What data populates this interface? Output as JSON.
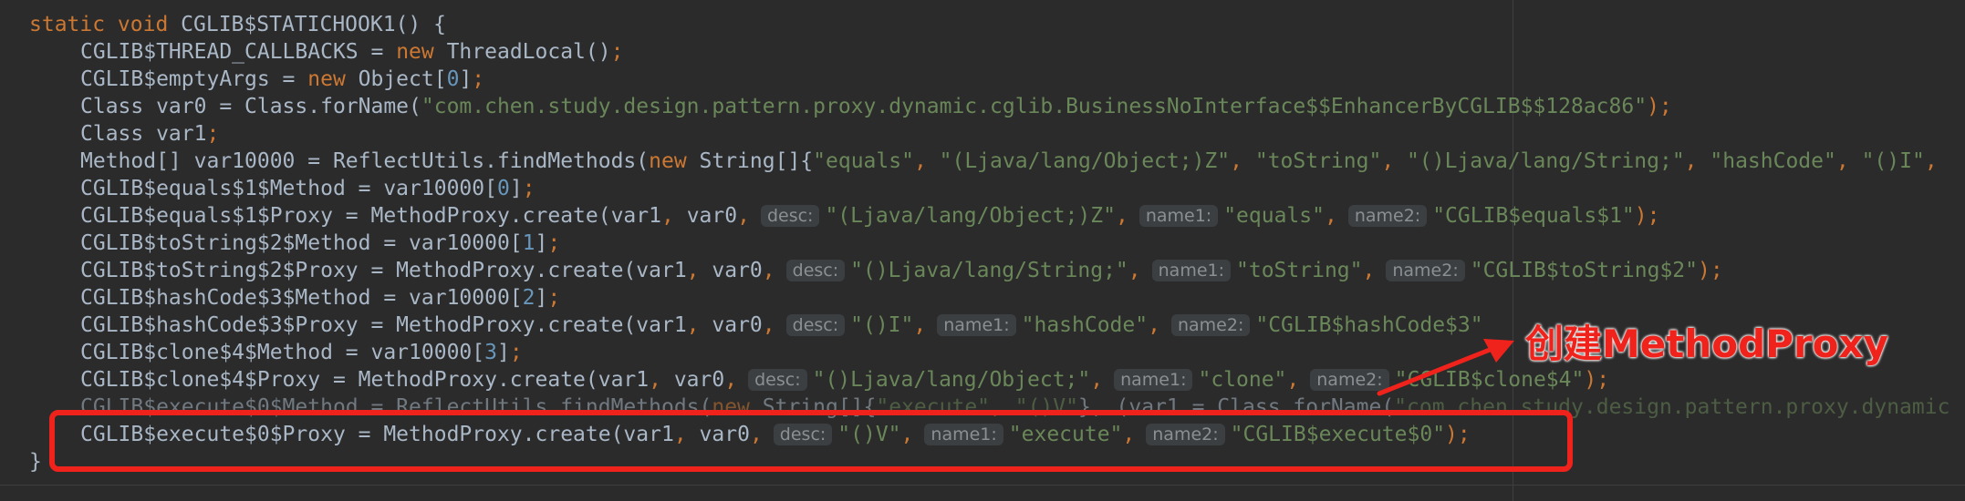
{
  "colors": {
    "background": "#2b2b2b",
    "keyword": "#cc7832",
    "string": "#6a8759",
    "number": "#6897bb",
    "plain": "#a9b7c6",
    "annotation_red": "#f0231c"
  },
  "code": {
    "method_signature": {
      "kw": "static void ",
      "name": "CGLIB$STATICHOOK1() {"
    },
    "l2": {
      "a": "CGLIB$THREAD_CALLBACKS = ",
      "kw": "new",
      "b": " ThreadLocal()",
      "end": ";"
    },
    "l3": {
      "a": "CGLIB$emptyArgs = ",
      "kw": "new",
      "b": " Object[",
      "num": "0",
      "c": "]",
      "end": ";"
    },
    "l4": {
      "a": "Class var0 = Class.forName(",
      "str": "\"com.chen.study.design.pattern.proxy.dynamic.cglib.BusinessNoInterface$$EnhancerByCGLIB$$128ac86\"",
      "end": ");"
    },
    "l5": {
      "a": "Class var1",
      "end": ";"
    },
    "l6": {
      "a": "Method[] var10000 = ReflectUtils.findMethods(",
      "kw": "new",
      "b": " String[]{",
      "s1": "\"equals\"",
      "s2": "\"(Ljava/lang/Object;)Z\"",
      "s3": "\"toString\"",
      "s4": "\"()Ljava/lang/String;\"",
      "s5": "\"hashCode\"",
      "s6": "\"()I\"",
      "sep": ", "
    },
    "l7": {
      "a": "CGLIB$equals$1$Method = var10000[",
      "num": "0",
      "b": "]",
      "end": ";"
    },
    "l8": {
      "a": "CGLIB$equals$1$Proxy = MethodProxy.create(var1",
      "b": " var0",
      "desc": "\"(Ljava/lang/Object;)Z\"",
      "name1": "\"equals\"",
      "name2": "\"CGLIB$equals$1\"",
      "end": ");"
    },
    "l9": {
      "a": "CGLIB$toString$2$Method = var10000[",
      "num": "1",
      "b": "]",
      "end": ";"
    },
    "l10": {
      "a": "CGLIB$toString$2$Proxy = MethodProxy.create(var1",
      "b": " var0",
      "desc": "\"()Ljava/lang/String;\"",
      "name1": "\"toString\"",
      "name2": "\"CGLIB$toString$2\"",
      "end": ");"
    },
    "l11": {
      "a": "CGLIB$hashCode$3$Method = var10000[",
      "num": "2",
      "b": "]",
      "end": ";"
    },
    "l12": {
      "a": "CGLIB$hashCode$3$Proxy = MethodProxy.create(var1",
      "b": " var0",
      "desc": "\"()I\"",
      "name1": "\"hashCode\"",
      "name2": "\"CGLIB$hashCode$3\""
    },
    "l13": {
      "a": "CGLIB$clone$4$Method = var10000[",
      "num": "3",
      "b": "]",
      "end": ";"
    },
    "l14": {
      "a": "CGLIB$clone$4$Proxy = MethodProxy.create(var1",
      "b": " var0",
      "desc": "\"()Ljava/lang/Object;\"",
      "name1": "\"clone\"",
      "name2": "\"CGLIB$clone$4\"",
      "end": ");"
    },
    "l15": {
      "a": "CGLIB$execute$0$Method = ReflectUtils.findMethods(",
      "kw": "new",
      "b": " String[]{",
      "s1": "\"execute\"",
      "s2": "\"()V\"",
      "c": "}, (var1 = Class.forName(",
      "s3": "\"com.chen.study.design.pattern.proxy.dynamic"
    },
    "l16": {
      "a": "CGLIB$execute$0$Proxy = MethodProxy.create(var1",
      "b": " var0",
      "desc": "\"()V\"",
      "name1": "\"execute\"",
      "name2": "\"CGLIB$execute$0\"",
      "end": ");"
    },
    "closing_brace": "}",
    "comma": ",",
    "hint_desc": "desc:",
    "hint_name1": "name1:",
    "hint_name2": "name2:"
  },
  "annotation": {
    "label": "创建MethodProxy"
  }
}
